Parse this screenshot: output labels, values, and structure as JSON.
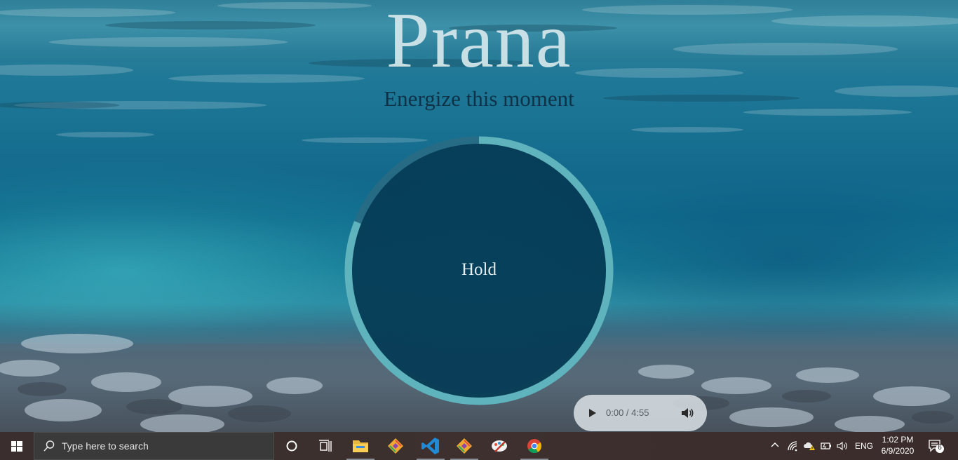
{
  "app": {
    "title": "Prana",
    "subtitle": "Energize this moment"
  },
  "breath": {
    "phase_label": "Hold",
    "progress_fraction": 0.81
  },
  "player": {
    "time": "0:00 / 4:55",
    "play_icon": "play-icon",
    "volume_icon": "volume-icon"
  },
  "taskbar": {
    "search_placeholder": "Type here to search",
    "pinned_apps": [
      "cortana",
      "task-view",
      "file-explorer",
      "git-gui",
      "visual-studio-code",
      "git-gui",
      "paint-app",
      "google-chrome"
    ],
    "tray": {
      "language": "ENG",
      "time": "1:02 PM",
      "date": "6/9/2020",
      "notification_count": "6"
    }
  },
  "colors": {
    "ring_progress": "#5fb3bd",
    "ring_track": "#2d6b82",
    "circle_fill": "#063e58",
    "title": "#d6e8ec",
    "subtitle": "#0e3247",
    "taskbar": "#3a2f2e"
  }
}
